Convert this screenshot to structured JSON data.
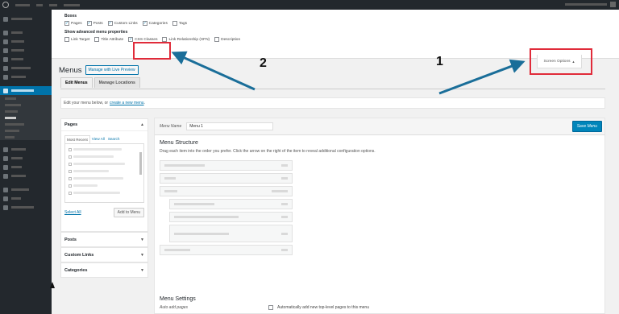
{
  "screen_options": {
    "boxes_heading": "Boxes",
    "boxes": [
      {
        "label": "Pages",
        "checked": true
      },
      {
        "label": "Posts",
        "checked": true
      },
      {
        "label": "Custom Links",
        "checked": true
      },
      {
        "label": "Categories",
        "checked": true
      },
      {
        "label": "Tags",
        "checked": false
      }
    ],
    "advanced_heading": "Show advanced menu properties",
    "advanced": [
      {
        "label": "Link Target",
        "checked": false
      },
      {
        "label": "Title Attribute",
        "checked": false
      },
      {
        "label": "CSS Classes",
        "checked": true
      },
      {
        "label": "Link Relationship (XFN)",
        "checked": false
      },
      {
        "label": "Description",
        "checked": false
      }
    ],
    "tab_label": "Screen Options",
    "tab_caret": "▲"
  },
  "page": {
    "title": "Menus",
    "live_preview": "Manage with Live Preview",
    "tabs": [
      "Edit Menus",
      "Manage Locations"
    ],
    "manage_text": "Edit your menu below, or",
    "manage_link": "create a new menu",
    "manage_end": "."
  },
  "left": {
    "pages_title": "Pages",
    "sub_tabs": [
      "Most Recent",
      "View All",
      "Search"
    ],
    "select_all": "Select All",
    "add_button": "Add to Menu",
    "sections": [
      "Posts",
      "Custom Links",
      "Categories"
    ]
  },
  "menu": {
    "name_label": "Menu Name",
    "name_value": "Menu 1",
    "save_label": "Save Menu",
    "structure_title": "Menu Structure",
    "structure_desc": "Drag each item into the order you prefer. Click the arrow on the right of the item to reveal additional configuration options.",
    "settings_title": "Menu Settings",
    "auto_label": "Auto add pages",
    "auto_desc": "Automatically add new top-level pages to this menu"
  },
  "annotations": {
    "one": "1",
    "two": "2",
    "arrow_color": "#1a6e99",
    "highlight_color": "#e02b3a"
  },
  "colors": {
    "admin_bar": "#23282d",
    "accent": "#0073aa",
    "primary_button": "#0085ba"
  }
}
